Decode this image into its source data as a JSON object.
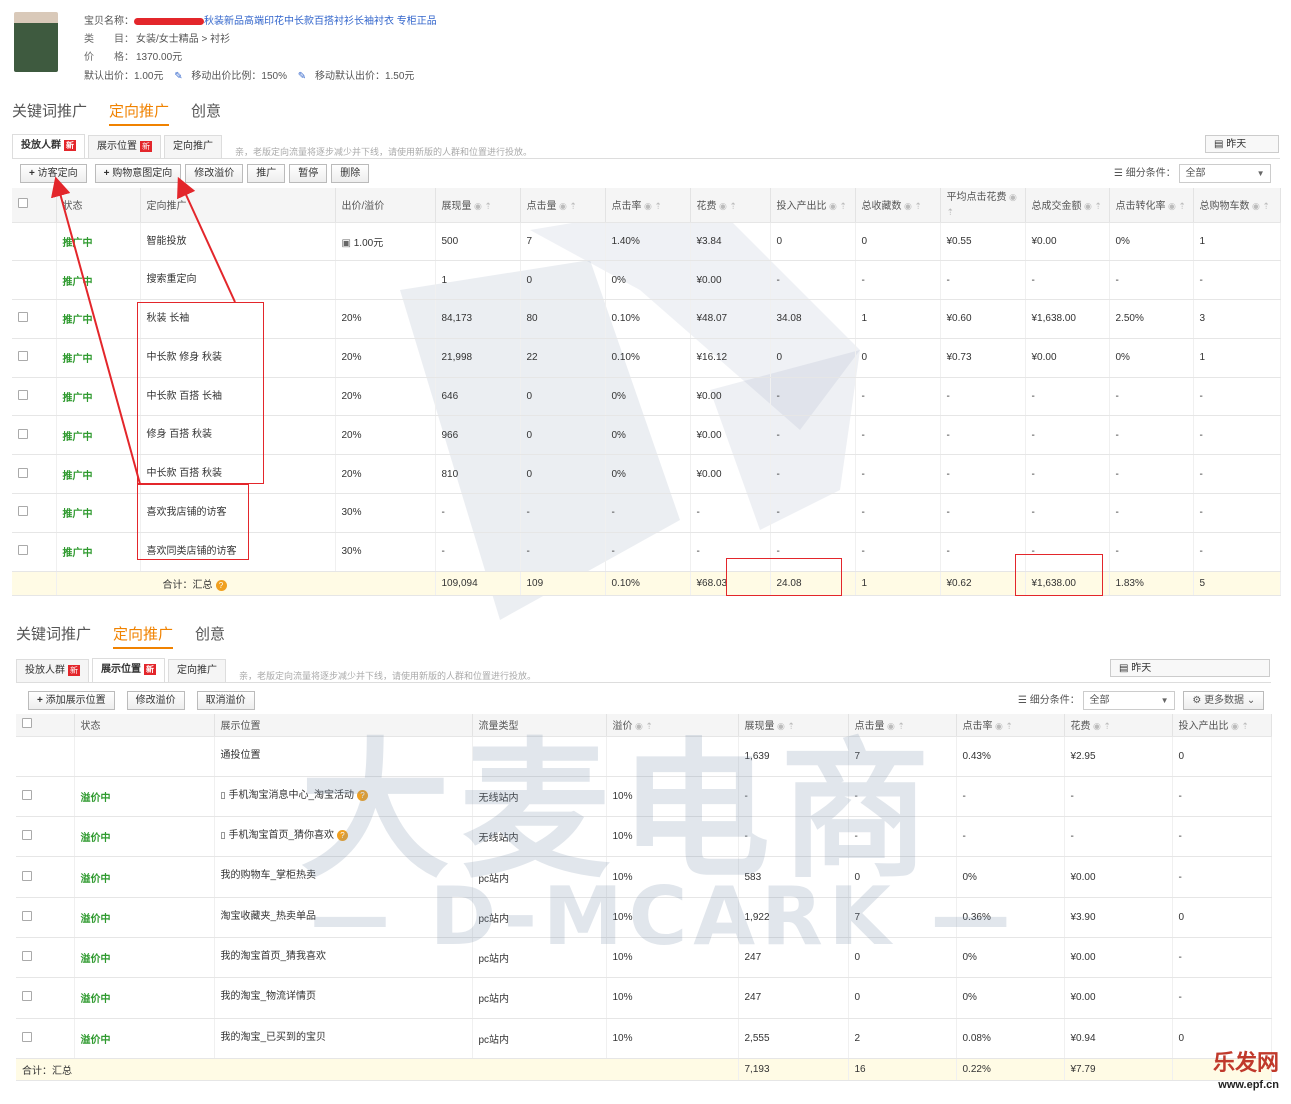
{
  "product": {
    "label_name": "宝贝名称：",
    "name_visible": "秋装新品高端印花中长款百搭衬衫长袖衬衣 专柜正品",
    "label_category": "类　　目：",
    "category": "女装/女士精品 > 衬衫",
    "label_price": "价　　格：",
    "price": "1370.00元",
    "default_bid_label": "默认出价：",
    "default_bid": "1.00元",
    "mobile_ratio_label": "移动出价比例：",
    "mobile_ratio": "150%",
    "mobile_default_label": "移动默认出价：",
    "mobile_default": "1.50元"
  },
  "main_tabs": [
    "关键词推广",
    "定向推广",
    "创意"
  ],
  "notice": "亲，老版定向流量将逐步减少并下线，请使用新版的人群和位置进行投放。",
  "date_label": "昨天",
  "new_badge": "新",
  "filter_label": "细分条件：",
  "filter_value": "全部",
  "table1": {
    "subtabs": [
      "投放人群",
      "展示位置",
      "定向推广"
    ],
    "buttons": [
      "访客定向",
      "购物意图定向",
      "修改溢价",
      "推广",
      "暂停",
      "删除"
    ],
    "headers": [
      "状态",
      "定向推广",
      "出价/溢价",
      "展现量",
      "点击量",
      "点击率",
      "花费",
      "投入产出比",
      "总收藏数",
      "平均点击花费",
      "总成交金额",
      "点击转化率",
      "总购物车数"
    ],
    "rows": [
      {
        "status": "推广中",
        "name": "智能投放",
        "bid": "1.00元",
        "impr": "500",
        "clicks": "7",
        "ctr": "1.40%",
        "cost": "¥3.84",
        "roi": "0",
        "fav": "0",
        "cpc": "¥0.55",
        "gmv": "¥0.00",
        "cvr": "0%",
        "cart": "1"
      },
      {
        "status": "推广中",
        "name": "搜索重定向",
        "bid": "",
        "impr": "1",
        "clicks": "0",
        "ctr": "0%",
        "cost": "¥0.00",
        "roi": "-",
        "fav": "-",
        "cpc": "-",
        "gmv": "-",
        "cvr": "-",
        "cart": "-"
      },
      {
        "status": "推广中",
        "name": "秋装 长袖",
        "bid": "20%",
        "impr": "84,173",
        "clicks": "80",
        "ctr": "0.10%",
        "cost": "¥48.07",
        "roi": "34.08",
        "fav": "1",
        "cpc": "¥0.60",
        "gmv": "¥1,638.00",
        "cvr": "2.50%",
        "cart": "3"
      },
      {
        "status": "推广中",
        "name": "中长款 修身 秋装",
        "bid": "20%",
        "impr": "21,998",
        "clicks": "22",
        "ctr": "0.10%",
        "cost": "¥16.12",
        "roi": "0",
        "fav": "0",
        "cpc": "¥0.73",
        "gmv": "¥0.00",
        "cvr": "0%",
        "cart": "1"
      },
      {
        "status": "推广中",
        "name": "中长款 百搭 长袖",
        "bid": "20%",
        "impr": "646",
        "clicks": "0",
        "ctr": "0%",
        "cost": "¥0.00",
        "roi": "-",
        "fav": "-",
        "cpc": "-",
        "gmv": "-",
        "cvr": "-",
        "cart": "-"
      },
      {
        "status": "推广中",
        "name": "修身 百搭 秋装",
        "bid": "20%",
        "impr": "966",
        "clicks": "0",
        "ctr": "0%",
        "cost": "¥0.00",
        "roi": "-",
        "fav": "-",
        "cpc": "-",
        "gmv": "-",
        "cvr": "-",
        "cart": "-"
      },
      {
        "status": "推广中",
        "name": "中长款 百搭 秋装",
        "bid": "20%",
        "impr": "810",
        "clicks": "0",
        "ctr": "0%",
        "cost": "¥0.00",
        "roi": "-",
        "fav": "-",
        "cpc": "-",
        "gmv": "-",
        "cvr": "-",
        "cart": "-"
      },
      {
        "status": "推广中",
        "name": "喜欢我店铺的访客",
        "bid": "30%",
        "impr": "-",
        "clicks": "-",
        "ctr": "-",
        "cost": "-",
        "roi": "-",
        "fav": "-",
        "cpc": "-",
        "gmv": "-",
        "cvr": "-",
        "cart": "-"
      },
      {
        "status": "推广中",
        "name": "喜欢同类店铺的访客",
        "bid": "30%",
        "impr": "-",
        "clicks": "-",
        "ctr": "-",
        "cost": "-",
        "roi": "-",
        "fav": "-",
        "cpc": "-",
        "gmv": "-",
        "cvr": "-",
        "cart": "-"
      }
    ],
    "total": {
      "label": "合计：汇总",
      "impr": "109,094",
      "clicks": "109",
      "ctr": "0.10%",
      "cost": "¥68.03",
      "roi": "24.08",
      "fav": "1",
      "cpc": "¥0.62",
      "gmv": "¥1,638.00",
      "cvr": "1.83%",
      "cart": "5"
    }
  },
  "table2": {
    "subtabs": [
      "投放人群",
      "展示位置",
      "定向推广"
    ],
    "buttons": [
      "添加展示位置",
      "修改溢价",
      "取消溢价"
    ],
    "more_data": "更多数据",
    "headers": [
      "状态",
      "展示位置",
      "流量类型",
      "溢价",
      "展现量",
      "点击量",
      "点击率",
      "花费",
      "投入产出比"
    ],
    "rows": [
      {
        "status": "",
        "name": "通投位置",
        "type": "",
        "premium": "",
        "impr": "1,639",
        "clicks": "7",
        "ctr": "0.43%",
        "cost": "¥2.95",
        "roi": "0"
      },
      {
        "status": "溢价中",
        "name": "手机淘宝消息中心_淘宝活动",
        "type": "无线站内",
        "premium": "10%",
        "impr": "-",
        "clicks": "-",
        "ctr": "-",
        "cost": "-",
        "roi": "-"
      },
      {
        "status": "溢价中",
        "name": "手机淘宝首页_猜你喜欢",
        "type": "无线站内",
        "premium": "10%",
        "impr": "-",
        "clicks": "-",
        "ctr": "-",
        "cost": "-",
        "roi": "-"
      },
      {
        "status": "溢价中",
        "name": "我的购物车_掌柜热卖",
        "type": "pc站内",
        "premium": "10%",
        "impr": "583",
        "clicks": "0",
        "ctr": "0%",
        "cost": "¥0.00",
        "roi": "-"
      },
      {
        "status": "溢价中",
        "name": "淘宝收藏夹_热卖单品",
        "type": "pc站内",
        "premium": "10%",
        "impr": "1,922",
        "clicks": "7",
        "ctr": "0.36%",
        "cost": "¥3.90",
        "roi": "0"
      },
      {
        "status": "溢价中",
        "name": "我的淘宝首页_猜我喜欢",
        "type": "pc站内",
        "premium": "10%",
        "impr": "247",
        "clicks": "0",
        "ctr": "0%",
        "cost": "¥0.00",
        "roi": "-"
      },
      {
        "status": "溢价中",
        "name": "我的淘宝_物流详情页",
        "type": "pc站内",
        "premium": "10%",
        "impr": "247",
        "clicks": "0",
        "ctr": "0%",
        "cost": "¥0.00",
        "roi": "-"
      },
      {
        "status": "溢价中",
        "name": "我的淘宝_已买到的宝贝",
        "type": "pc站内",
        "premium": "10%",
        "impr": "2,555",
        "clicks": "2",
        "ctr": "0.08%",
        "cost": "¥0.94",
        "roi": "0"
      }
    ],
    "total": {
      "label": "合计：汇总",
      "impr": "7,193",
      "clicks": "16",
      "ctr": "0.22%",
      "cost": "¥7.79",
      "roi": ""
    }
  },
  "watermark": {
    "big": "大麦电商",
    "brand": "D-MCARK"
  },
  "corner_logo": {
    "cn": "乐发网",
    "url": "www.epf.cn"
  }
}
